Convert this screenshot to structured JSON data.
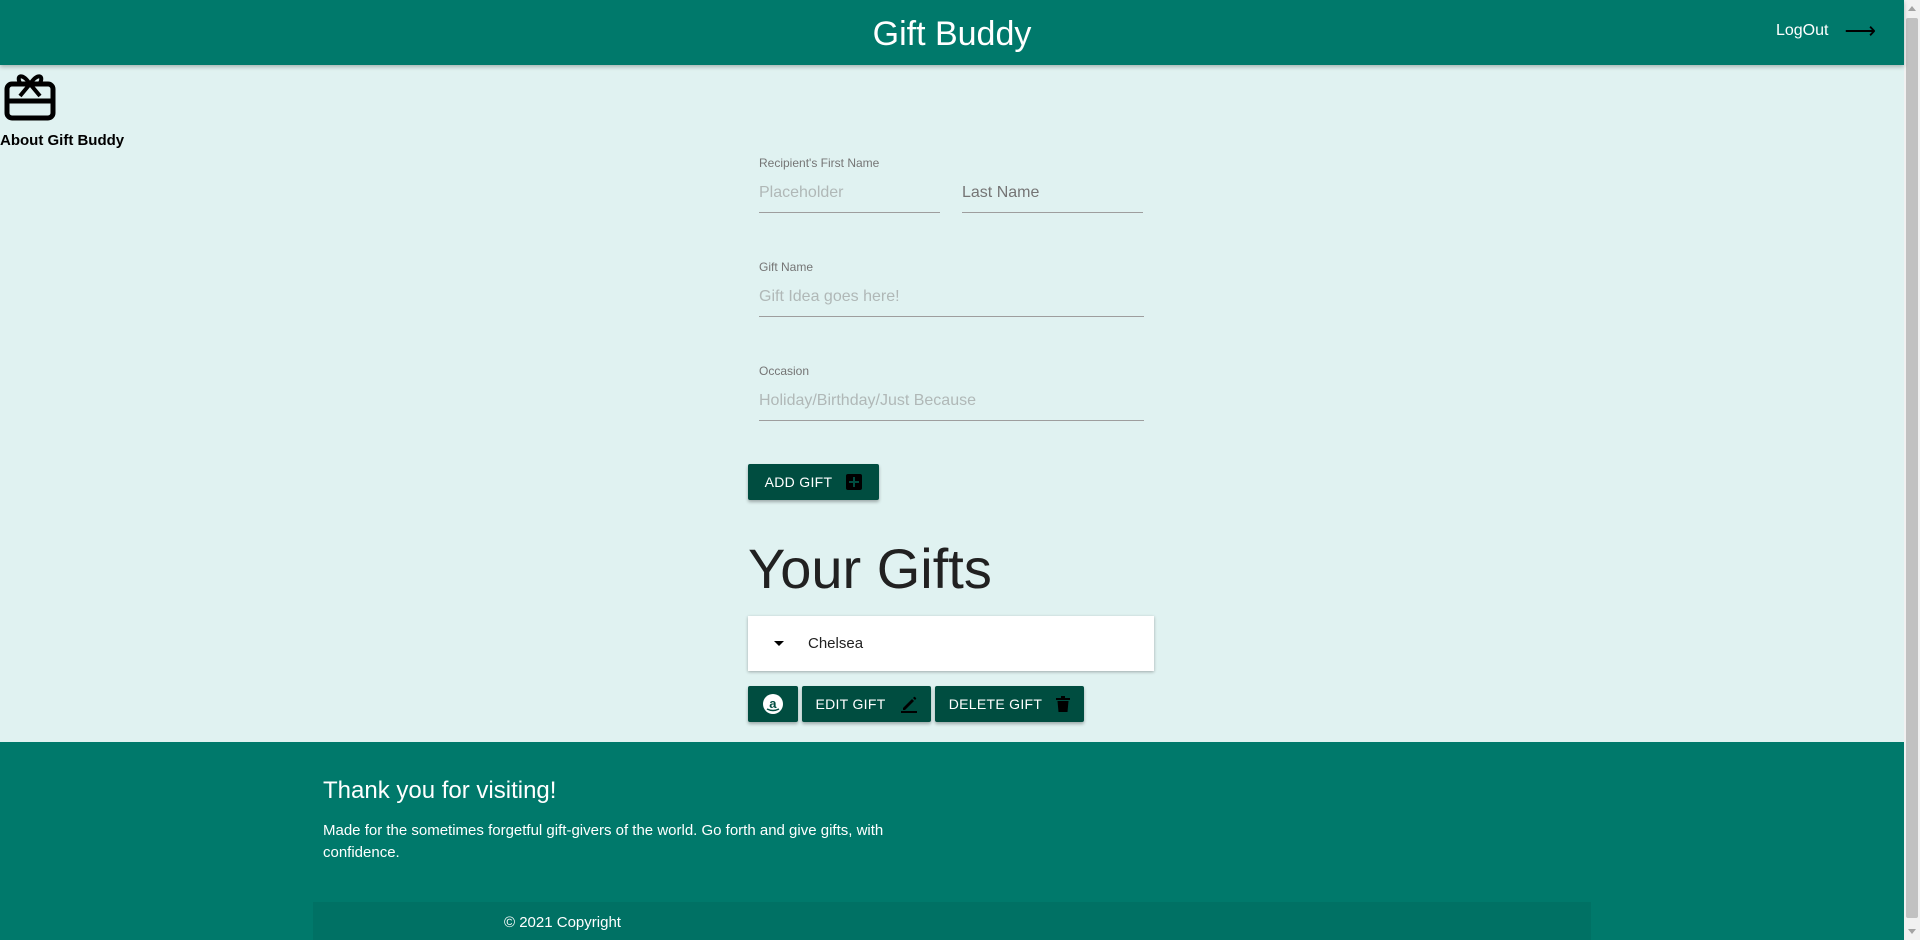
{
  "header": {
    "title": "Gift Buddy",
    "logout_label": "LogOut"
  },
  "about": {
    "label": "About Gift Buddy"
  },
  "form": {
    "first_name": {
      "label": "Recipient's First Name",
      "placeholder": "Placeholder",
      "value": ""
    },
    "last_name": {
      "placeholder": "Last Name",
      "value": ""
    },
    "gift_name": {
      "label": "Gift Name",
      "placeholder": "Gift Idea goes here!",
      "value": ""
    },
    "occasion": {
      "label": "Occasion",
      "placeholder": "Holiday/Birthday/Just Because",
      "value": ""
    },
    "add_button": "ADD GIFT"
  },
  "gifts": {
    "title": "Your Gifts",
    "items": [
      {
        "name": "Chelsea"
      }
    ],
    "edit_button": "EDIT GIFT",
    "delete_button": "DELETE GIFT"
  },
  "footer": {
    "heading": "Thank you for visiting!",
    "text": "Made for the sometimes forgetful gift-givers of the world. Go forth and give gifts, with confidence.",
    "copyright": "© 2021 Copyright"
  },
  "icons": {
    "about": "gift-card-icon",
    "logout": "arrow-right-icon",
    "add": "add-box-icon",
    "amazon": "amazon-icon",
    "edit": "pencil-icon",
    "delete": "trash-icon",
    "expand": "caret-down-icon"
  },
  "colors": {
    "primary": "#00796b",
    "dark": "#004d40",
    "background": "#e0f2f1"
  }
}
